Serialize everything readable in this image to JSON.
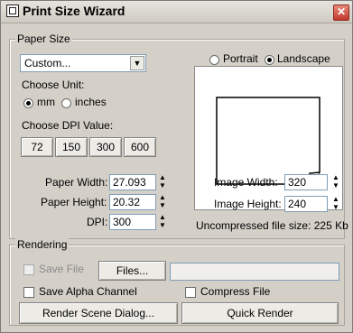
{
  "window": {
    "title": "Print Size Wizard",
    "close_glyph": "✕"
  },
  "paper_size": {
    "group_label": "Paper Size",
    "preset_value": "Custom...",
    "orientation": {
      "portrait_label": "Portrait",
      "landscape_label": "Landscape",
      "selected": "Landscape"
    },
    "unit_label": "Choose Unit:",
    "unit_mm": "mm",
    "unit_inches": "inches",
    "unit_selected": "mm",
    "dpi_label": "Choose DPI Value:",
    "dpi_buttons": [
      "72",
      "150",
      "300",
      "600"
    ],
    "paper_width_label": "Paper Width:",
    "paper_width_value": "27.093",
    "paper_height_label": "Paper Height:",
    "paper_height_value": "20.32",
    "dpi_field_label": "DPI:",
    "dpi_value": "300",
    "image_width_label": "Image Width:",
    "image_width_value": "320",
    "image_height_label": "Image Height:",
    "image_height_value": "240",
    "file_size_text": "Uncompressed file size: 225 Kb"
  },
  "rendering": {
    "group_label": "Rendering",
    "save_file_label": "Save File",
    "files_button": "Files...",
    "file_path": "",
    "save_alpha_label": "Save Alpha Channel",
    "compress_label": "Compress File",
    "render_dialog_button": "Render Scene Dialog...",
    "quick_render_button": "Quick Render"
  }
}
